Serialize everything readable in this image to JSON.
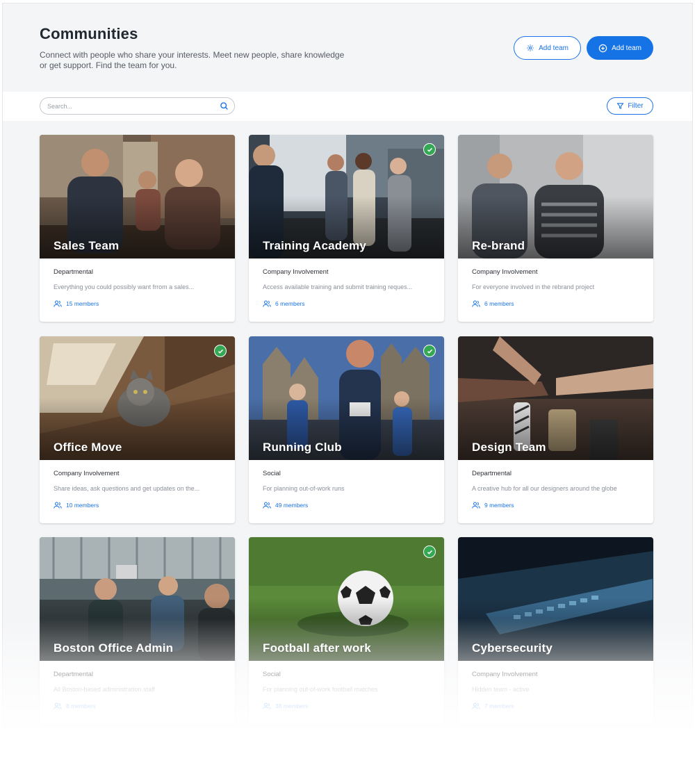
{
  "header": {
    "title": "Communities",
    "description": "Connect with people who share your interests. Meet new people, share knowledge or get support. Find the team for you.",
    "add_team_outline_label": "Add team",
    "add_team_primary_label": "Add team"
  },
  "toolbar": {
    "search_placeholder": "Search...",
    "filter_label": "Filter"
  },
  "colors": {
    "accent": "#1573e6",
    "check": "#34a853",
    "background": "#f4f5f7"
  },
  "cards": [
    {
      "title": "Sales Team",
      "category": "Departmental",
      "description": "Everything you could possibly want frrom a sales...",
      "members": "15 members",
      "joined": false
    },
    {
      "title": "Training Academy",
      "category": "Company Involvement",
      "description": "Access available training and submit training reques...",
      "members": "6 members",
      "joined": true
    },
    {
      "title": "Re-brand",
      "category": "Company Involvement",
      "description": "For everyone involved in the rebrand project",
      "members": "6 members",
      "joined": false
    },
    {
      "title": "Office Move",
      "category": "Company Involvement",
      "description": "Share ideas, ask questions and get updates on the...",
      "members": "10 members",
      "joined": true
    },
    {
      "title": "Running Club",
      "category": "Social",
      "description": "For planning out-of-work runs",
      "members": "49 members",
      "joined": true
    },
    {
      "title": "Design Team",
      "category": "Departmental",
      "description": "A creative hub for all our designers around the globe",
      "members": "9 members",
      "joined": false
    },
    {
      "title": "Boston Office Admin",
      "category": "Departmental",
      "description": "All Boston-based administration staff",
      "members": "8 members",
      "joined": false
    },
    {
      "title": "Football after work",
      "category": "Social",
      "description": "For planning out-of-work football matches",
      "members": "38 members",
      "joined": true
    },
    {
      "title": "Cybersecurity",
      "category": "Company Involvement",
      "description": "Hidden team - active",
      "members": "7 members",
      "joined": false
    }
  ]
}
